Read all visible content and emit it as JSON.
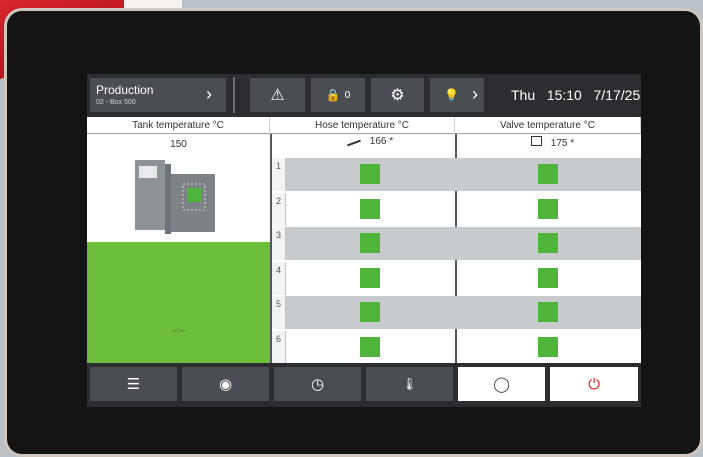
{
  "header": {
    "title": "Production",
    "subtitle": "02 - Box 500",
    "title_chevron": "›",
    "warning_icon": "⚠",
    "lock_icon": "🔒",
    "lock_count": "0",
    "globe_icon": "⚙",
    "bulb_icon": "💡",
    "bulb_chevron": "›",
    "day": "Thu",
    "time": "15:10",
    "date": "7/17/25"
  },
  "columns": {
    "tank": "Tank temperature °C",
    "hose": "Hose temperature °C",
    "valve": "Valve temperature °C"
  },
  "values": {
    "tank": "150",
    "hose": "166 *",
    "valve": "175 *",
    "tank_level": "--:--"
  },
  "zones": [
    "1",
    "2",
    "3",
    "4",
    "5",
    "6"
  ],
  "footer": {
    "list": "☰",
    "eye": "◉",
    "gauge": "◷",
    "thermo": "🌡",
    "clock": "◯",
    "power": "⏻"
  },
  "colors": {
    "header_bg": "#2b2d30",
    "button_bg": "#4a4d51",
    "status_green": "#4fb43a",
    "tank_green": "#6bbf3a",
    "power_red": "#e01e1e"
  }
}
